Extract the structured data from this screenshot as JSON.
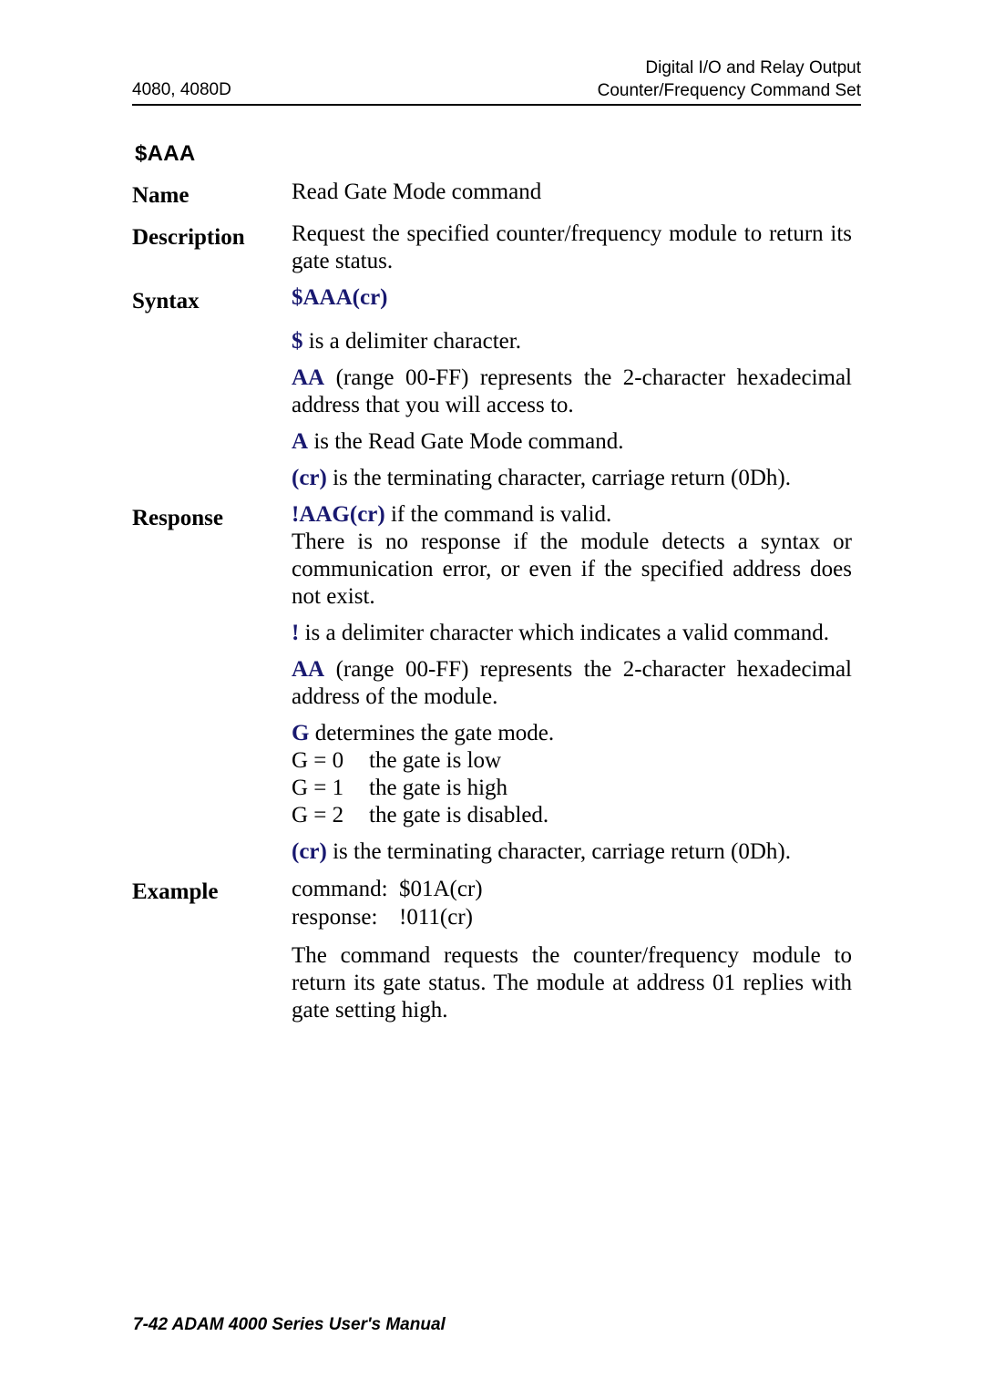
{
  "header": {
    "left": "4080, 4080D",
    "right_line1": "Digital I/O and Relay Output",
    "right_line2": "Counter/Frequency Command Set"
  },
  "command": {
    "title": "$AAA",
    "accent_color": "#191970",
    "rows": {
      "name": {
        "label": "Name",
        "value": "Read Gate Mode command"
      },
      "description": {
        "label": "Description",
        "value": "Request the specified counter/frequency module to return its gate status."
      },
      "syntax": {
        "label": "Syntax",
        "value_accent": "$AAA(cr)",
        "details": [
          {
            "token": "$",
            "text": " is a delimiter character."
          },
          {
            "token": "AA",
            "text": " (range 00-FF) represents the 2-character hexadecimal address that you will access to."
          },
          {
            "token": "A",
            "text": " is the Read Gate Mode command."
          },
          {
            "token": "(cr)",
            "text": " is the terminating character, carriage return (0Dh)."
          }
        ]
      },
      "response": {
        "label": "Response",
        "value_accent": "!AAG(cr)",
        "value_rest": " if the command is valid.",
        "paragraph": "There is no response if the module detects a syntax or communication error, or even if the specified address does not exist.",
        "details": [
          {
            "token": "!",
            "text": " is a delimiter character which indicates a valid command."
          },
          {
            "token": "AA",
            "text": " (range 00-FF) represents the 2-character hexadecimal address of the module."
          }
        ],
        "gate_intro": {
          "token": "G",
          "text": " determines the gate mode."
        },
        "gate_modes": [
          {
            "key": "G = 0",
            "value": "the gate is low"
          },
          {
            "key": "G = 1",
            "value": "the gate is high"
          },
          {
            "key": "G = 2",
            "value": "the gate is disabled."
          }
        ],
        "terminator": {
          "token": "(cr)",
          "text": " is the terminating character, carriage return (0Dh)."
        }
      },
      "example": {
        "label": "Example",
        "lines": [
          {
            "key": "command:",
            "value": "$01A(cr)"
          },
          {
            "key": "response:",
            "value": "!011(cr)"
          }
        ],
        "paragraph": "The command requests the counter/frequency module to return its gate status. The module at address 01 replies with gate setting high."
      }
    }
  },
  "footer": {
    "text": "7-42 ADAM 4000 Series User's Manual"
  }
}
